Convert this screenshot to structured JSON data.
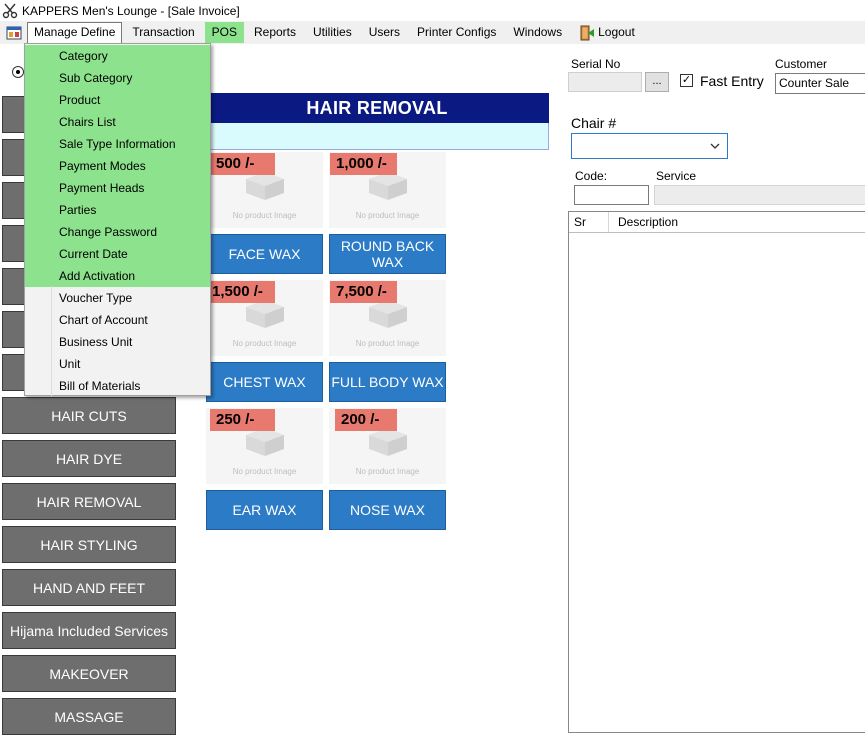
{
  "window": {
    "title": "KAPPERS Men's Lounge - [Sale Invoice]"
  },
  "menubar": {
    "items": [
      "Manage Define",
      "Transaction",
      "POS",
      "Reports",
      "Utilities",
      "Users",
      "Printer Configs",
      "Windows"
    ],
    "logout_label": "Logout"
  },
  "dropdown": {
    "items": [
      "Category",
      "Sub Category",
      "Product",
      "Chairs List",
      "Sale Type Information",
      "Payment Modes",
      "Payment Heads",
      "Parties",
      "Change Password",
      "Current Date",
      "Add Activation",
      "Voucher Type",
      "Chart of Account",
      "Business Unit",
      "Unit",
      "Bill of Materials"
    ]
  },
  "categories": [
    "HAIR CUTS",
    "HAIR DYE",
    "HAIR REMOVAL",
    "HAIR STYLING",
    "HAND AND FEET",
    "Hijama Included Services",
    "MAKEOVER",
    "MASSAGE"
  ],
  "main": {
    "banner_title": "HAIR REMOVAL",
    "no_image_text": "No product Image",
    "products": [
      {
        "price": "500 /-",
        "name": "FACE WAX"
      },
      {
        "price": "1,000 /-",
        "name": "ROUND BACK WAX"
      },
      {
        "price": "1,500 /-",
        "name": "CHEST WAX"
      },
      {
        "price": "7,500 /-",
        "name": "FULL BODY WAX"
      },
      {
        "price": "250 /-",
        "name": "EAR WAX"
      },
      {
        "price": "200 /-",
        "name": "NOSE WAX"
      }
    ]
  },
  "right": {
    "serial_label": "Serial No",
    "dots_label": "...",
    "fast_entry_label": "Fast Entry",
    "fast_entry_checked": true,
    "customer_label": "Customer",
    "customer_value": "Counter Sale",
    "chair_label": "Chair #",
    "code_label": "Code:",
    "service_label": "Service",
    "grid_columns": [
      "Sr",
      "Description"
    ]
  }
}
